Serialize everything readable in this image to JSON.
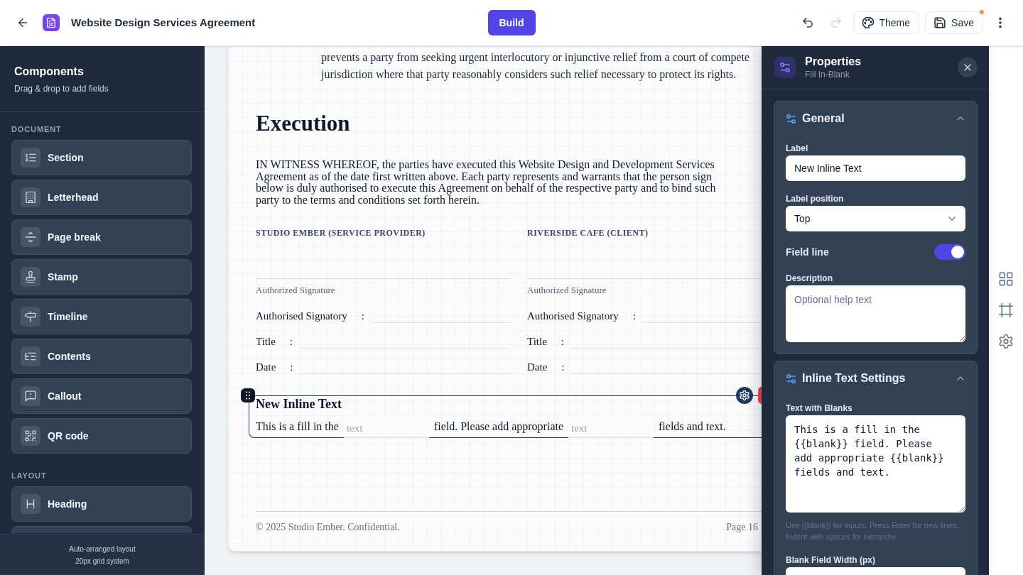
{
  "header": {
    "title": "Website Design Services Agreement",
    "build_label": "Build",
    "history": [
      {
        "kind": "undo",
        "disabled": false
      },
      {
        "kind": "redo",
        "disabled": true
      }
    ],
    "theme_label": "Theme",
    "save": {
      "label": "Save",
      "unsaved": true
    }
  },
  "sidebar": {
    "title": "Components",
    "subtitle": "Drag & drop to add fields",
    "groups": [
      {
        "heading": "DOCUMENT",
        "items": [
          {
            "kind": "section",
            "label": "Section"
          },
          {
            "kind": "letterhead",
            "label": "Letterhead"
          },
          {
            "kind": "pagebreak",
            "label": "Page break"
          },
          {
            "kind": "stamp",
            "label": "Stamp"
          },
          {
            "kind": "timeline",
            "label": "Timeline"
          },
          {
            "kind": "contents",
            "label": "Contents"
          },
          {
            "kind": "callout",
            "label": "Callout"
          },
          {
            "kind": "qrcode",
            "label": "QR code"
          }
        ]
      },
      {
        "heading": "LAYOUT",
        "items": [
          {
            "kind": "heading",
            "label": "Heading"
          }
        ]
      }
    ],
    "footer_lines": [
      "Auto-arranged layout",
      "20px grid system"
    ]
  },
  "document": {
    "top_paragraph_lines": [
      "prevents a party from seeking urgent interlocutory or injunctive relief from a court of compete",
      "jurisdiction where that party reasonably considers such relief necessary to protect its rights."
    ],
    "heading": "Execution",
    "witness_lines": [
      "IN WITNESS WHEREOF, the parties have executed this Website Design and Development Services",
      "Agreement as of the date first written above. Each party represents and warrants that the person sign",
      "below is duly authorised to execute this Agreement on behalf of the respective party and to bind such",
      "party to the terms and conditions set forth herein."
    ],
    "parties": [
      {
        "heading": "STUDIO EMBER (SERVICE PROVIDER)",
        "signature_caption": "Authorized Signature",
        "rows": [
          {
            "label": "Authorised Signatory",
            "separator": ":"
          },
          {
            "label": "Title",
            "separator": ":"
          },
          {
            "label": "Date",
            "separator": ":"
          }
        ]
      },
      {
        "heading": "RIVERSIDE CAFE (CLIENT)",
        "signature_caption": "Authorized Signature",
        "rows": [
          {
            "label": "Authorised Signatory",
            "separator": ":"
          },
          {
            "label": "Title",
            "separator": ":"
          },
          {
            "label": "Date",
            "separator": ":"
          }
        ]
      }
    ],
    "inline_block": {
      "selected": true,
      "title": "New Inline Text",
      "segments": [
        {
          "kind": "text",
          "text": "This is a fill in the"
        },
        {
          "kind": "blank",
          "placeholder": "text"
        },
        {
          "kind": "text",
          "text": "field. Please add appropriate"
        },
        {
          "kind": "blank",
          "placeholder": "text"
        },
        {
          "kind": "text",
          "text": "fields and text."
        }
      ]
    },
    "footer": {
      "copyright": "© 2025 Studio Ember. Confidential.",
      "page_number": "Page 16"
    }
  },
  "properties": {
    "title": "Properties",
    "subtitle": "Fill In-Blank",
    "sections": [
      {
        "title": "General",
        "expanded": true,
        "fields": [
          {
            "kind": "text",
            "label": "Label",
            "value": "New Inline Text"
          },
          {
            "kind": "select",
            "label": "Label position",
            "value": "Top"
          },
          {
            "kind": "toggle",
            "label": "Field line",
            "on": true
          },
          {
            "kind": "textarea",
            "label": "Description",
            "placeholder": "Optional help text"
          }
        ]
      },
      {
        "title": "Inline Text Settings",
        "expanded": true,
        "fields": [
          {
            "kind": "code",
            "label": "Text with Blanks",
            "value": "This is a fill in the {{blank}} field. Please add appropriate {{blank}} fields and text.",
            "help": "Use {{blank}} for inputs. Press Enter for new lines. Indent with spaces for hierarchy."
          },
          {
            "kind": "number",
            "label": "Blank Field Width (px)"
          }
        ]
      }
    ]
  }
}
